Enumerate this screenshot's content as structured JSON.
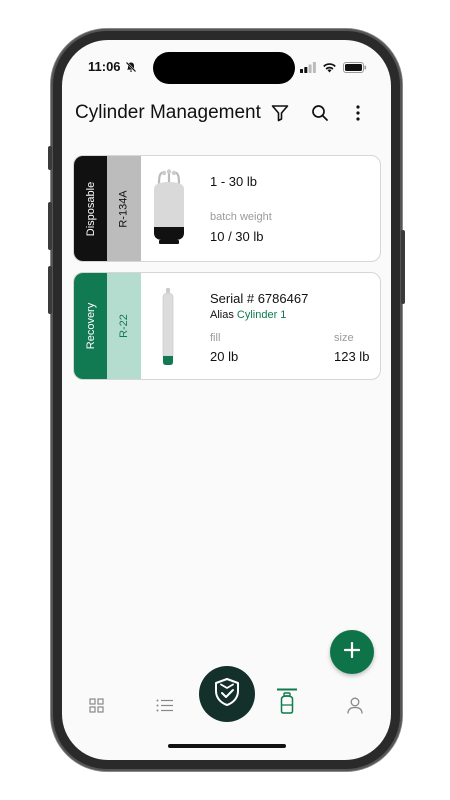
{
  "status": {
    "time": "11:06"
  },
  "appbar": {
    "title": "Cylinder Management",
    "icons": [
      "filter-icon",
      "search-icon",
      "more-vertical-icon"
    ]
  },
  "cylinders": [
    {
      "type": "Disposable",
      "refrigerant": "R-134A",
      "type_color": "#111111",
      "ref_color": "#bdbcbd",
      "heading": "1 - 30 lb",
      "weight_label": "batch weight",
      "weight_value": "10  / 30 lb"
    },
    {
      "type": "Recovery",
      "refrigerant": "R-22",
      "type_color": "#127a52",
      "ref_color": "#b4ddd0",
      "serial": "Serial # 6786467",
      "alias_label": "Alias",
      "alias_value": "Cylinder 1",
      "fill_label": "fill",
      "fill_value": "20 lb",
      "size_label": "size",
      "size_value": "123 lb"
    }
  ],
  "fab": {
    "icon": "plus-icon",
    "color": "#0f7349"
  },
  "bottom_nav": [
    "grid-icon",
    "list-icon",
    "shield-check-icon",
    "cylinder-icon",
    "user-icon"
  ],
  "colors": {
    "accent": "#0e7a4e",
    "nav_center": "#14302b"
  }
}
